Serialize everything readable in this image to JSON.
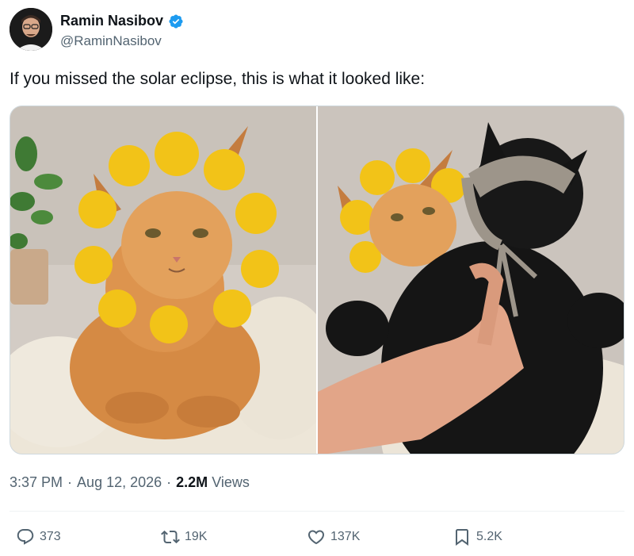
{
  "author": {
    "name": "Ramin Nasibov",
    "handle": "@RaminNasibov",
    "verified": true
  },
  "tweet": {
    "text": "If you missed the solar eclipse, this is what it looked like:"
  },
  "meta": {
    "time": "3:37 PM",
    "separator": "·",
    "date": "Aug 12, 2026",
    "views_count": "2.2M",
    "views_label": "Views"
  },
  "actions": {
    "replies": "373",
    "reposts": "19K",
    "likes": "137K",
    "bookmarks": "5.2K"
  },
  "colors": {
    "verified": "#1d9bf0",
    "text": "#0f1419",
    "muted": "#536471"
  },
  "icons": [
    "verified-badge-icon",
    "reply-icon",
    "repost-icon",
    "like-icon",
    "bookmark-icon"
  ]
}
